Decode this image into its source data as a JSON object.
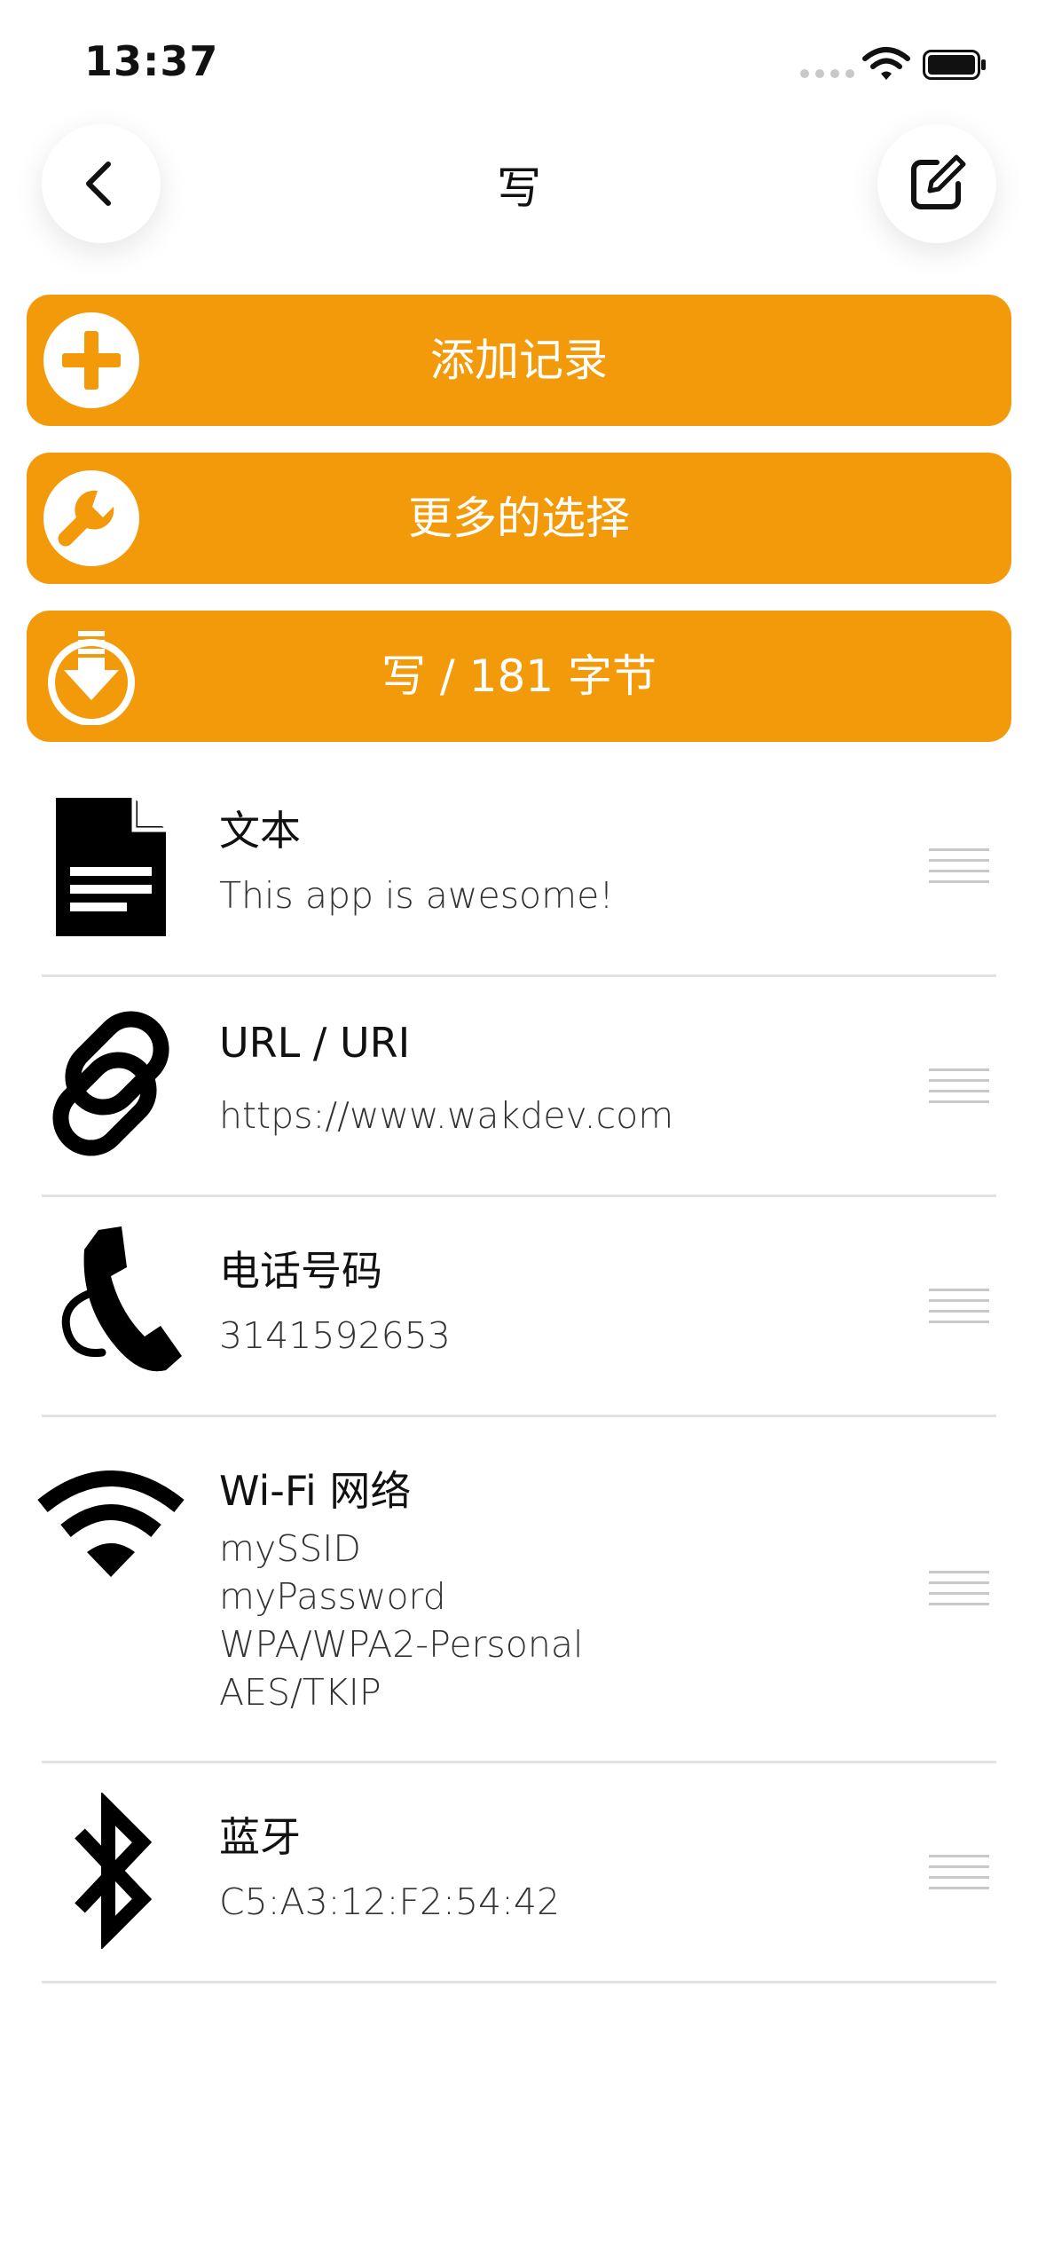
{
  "status_bar": {
    "time": "13:37"
  },
  "nav": {
    "title": "写",
    "back_icon": "chevron-left-icon",
    "edit_icon": "compose-icon"
  },
  "actions": [
    {
      "label": "添加记录",
      "icon": "plus-circle-icon"
    },
    {
      "label": "更多的选择",
      "icon": "wrench-icon"
    },
    {
      "label": "写 / 181 字节",
      "icon": "download-arrow-icon"
    }
  ],
  "records": [
    {
      "type": "文本",
      "icon": "document-icon",
      "lines": [
        "This app is awesome!"
      ]
    },
    {
      "type": "URL / URI",
      "icon": "link-icon",
      "lines": [
        "https://www.wakdev.com"
      ]
    },
    {
      "type": "电话号码",
      "icon": "phone-icon",
      "lines": [
        "3141592653"
      ]
    },
    {
      "type": "Wi-Fi 网络",
      "icon": "wifi-icon",
      "lines": [
        "mySSID",
        "myPassword",
        "WPA/WPA2-Personal",
        "AES/TKIP"
      ]
    },
    {
      "type": "蓝牙",
      "icon": "bluetooth-icon",
      "lines": [
        "C5:A3:12:F2:54:42"
      ]
    }
  ],
  "colors": {
    "accent": "#f39a0b",
    "divider": "#e3e3e3",
    "handle": "#c9c9c9"
  }
}
